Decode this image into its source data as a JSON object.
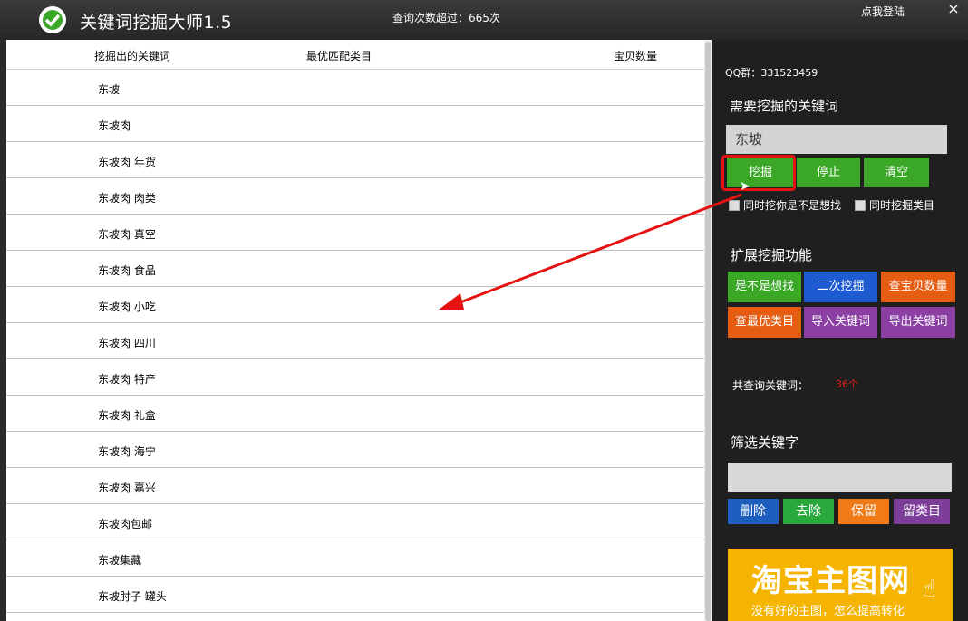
{
  "title_bar": {
    "app_title": "关键词挖掘大师1.5",
    "query_count": "查询次数超过：665次",
    "login_link": "点我登陆",
    "close_symbol": "×"
  },
  "results": {
    "columns": [
      "挖掘出的关键词",
      "最优匹配类目",
      "宝贝数量"
    ],
    "rows": [
      {
        "keyword": "东坡"
      },
      {
        "keyword": "东坡肉"
      },
      {
        "keyword": "东坡肉 年货"
      },
      {
        "keyword": "东坡肉 肉类"
      },
      {
        "keyword": "东坡肉 真空"
      },
      {
        "keyword": "东坡肉 食品"
      },
      {
        "keyword": "东坡肉 小吃"
      },
      {
        "keyword": "东坡肉 四川"
      },
      {
        "keyword": "东坡肉 特产"
      },
      {
        "keyword": "东坡肉 礼盒"
      },
      {
        "keyword": "东坡肉 海宁"
      },
      {
        "keyword": "东坡肉 嘉兴"
      },
      {
        "keyword": "东坡肉包邮"
      },
      {
        "keyword": "东坡集藏"
      },
      {
        "keyword": "东坡肘子 罐头"
      }
    ]
  },
  "panel": {
    "qq": "QQ群：331523459",
    "mine_title": "需要挖掘的关键词",
    "keyword_value": "东坡",
    "buttons": {
      "mine": "挖掘",
      "stop": "停止",
      "clear": "清空"
    },
    "checkbox_maybe": "同时挖你是不是想找",
    "checkbox_category": "同时挖掘类目",
    "extend_title": "扩展挖掘功能",
    "extend_buttons": [
      "是不是想找",
      "二次挖掘",
      "查宝贝数量",
      "查最优类目",
      "导入关键词",
      "导出关键词"
    ],
    "total_label": "共查询关键词：",
    "total_value": "36个",
    "filter_title": "筛选关键字",
    "filter_buttons": [
      "删除",
      "去除",
      "保留",
      "留类目"
    ],
    "banner_main": "淘宝主图网",
    "banner_sub": "没有好的主图，怎么提高转化"
  },
  "colors": {
    "accent_green": "#3aa726",
    "accent_blue": "#1f5bd0",
    "accent_orange": "#e55d12",
    "accent_purple": "#8b3fa3",
    "highlight_red": "#e51212",
    "banner_yellow": "#f5b400"
  },
  "icons": [
    "app-logo-icon",
    "close-icon",
    "cursor-icon",
    "hand-pointer-icon",
    "annotation-arrow"
  ]
}
